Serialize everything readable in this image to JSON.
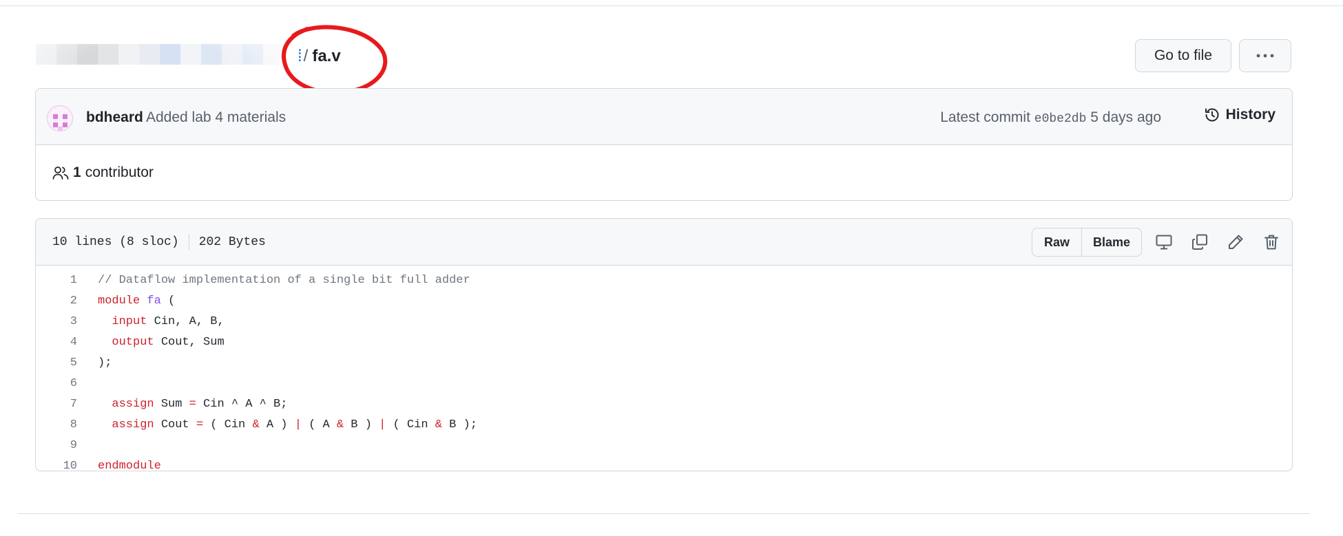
{
  "breadcrumb": {
    "separator": "/",
    "file_name": "fa.v",
    "redacted_color": "#c9d7f0",
    "annotation_color": "#e8191c"
  },
  "header_buttons": {
    "go_to_file": "Go to file",
    "more_icon": "kebab-horizontal-icon"
  },
  "commit": {
    "author": "bdheard",
    "message": "Added lab 4 materials",
    "latest_prefix": "Latest commit",
    "sha": "e0be2db",
    "relative_time": "5 days ago",
    "history_label": "History"
  },
  "contributors": {
    "count": "1",
    "label": "contributor"
  },
  "file": {
    "lines_info": "10 lines (8 sloc)",
    "size": "202 Bytes",
    "raw_label": "Raw",
    "blame_label": "Blame",
    "icons": [
      "desktop-icon",
      "copy-icon",
      "pencil-icon",
      "trash-icon"
    ]
  },
  "code": {
    "line_numbers": [
      "1",
      "2",
      "3",
      "4",
      "5",
      "6",
      "7",
      "8",
      "9",
      "10"
    ],
    "l1_comment": "// Dataflow implementation of a single bit full adder",
    "l2_kw": "module",
    "l2_name": "fa",
    "l2_rest": " (",
    "l3_kw": "input",
    "l3_rest": " Cin, A, B,",
    "l4_kw": "output",
    "l4_rest": " Cout, Sum",
    "l5": ");",
    "l7_kw": "assign",
    "l7_a": " Sum ",
    "l7_eq": "=",
    "l7_b": " Cin ^ A ^ B;",
    "l8_kw": "assign",
    "l8_a": " Cout ",
    "l8_eq": "=",
    "l8_b": " ( Cin ",
    "l8_and1": "&",
    "l8_c": " A ) ",
    "l8_or1": "|",
    "l8_d": " ( A ",
    "l8_and2": "&",
    "l8_e": " B ) ",
    "l8_or2": "|",
    "l8_f": " ( Cin ",
    "l8_and3": "&",
    "l8_g": " B );",
    "l10_kw": "endmodule"
  }
}
